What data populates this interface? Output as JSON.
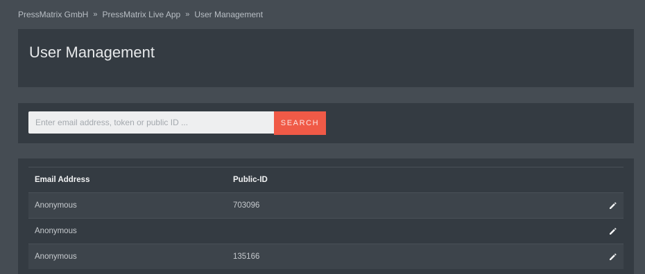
{
  "breadcrumb": {
    "items": [
      {
        "label": "PressMatrix GmbH"
      },
      {
        "label": "PressMatrix Live App"
      },
      {
        "label": "User Management"
      }
    ],
    "separator": "»"
  },
  "page": {
    "title": "User Management"
  },
  "search": {
    "placeholder": "Enter email address, token or public ID ...",
    "value": "",
    "button_label": "SEARCH"
  },
  "table": {
    "headers": {
      "email": "Email Address",
      "public_id": "Public-ID",
      "action": ""
    },
    "rows": [
      {
        "email": "Anonymous",
        "public_id": "703096",
        "action_icon": "edit-icon"
      },
      {
        "email": "Anonymous",
        "public_id": "",
        "action_icon": "edit-icon"
      },
      {
        "email": "Anonymous",
        "public_id": "135166",
        "action_icon": "edit-icon"
      }
    ]
  },
  "colors": {
    "background": "#454c53",
    "panel": "#343b42",
    "accent": "#f05a47"
  }
}
